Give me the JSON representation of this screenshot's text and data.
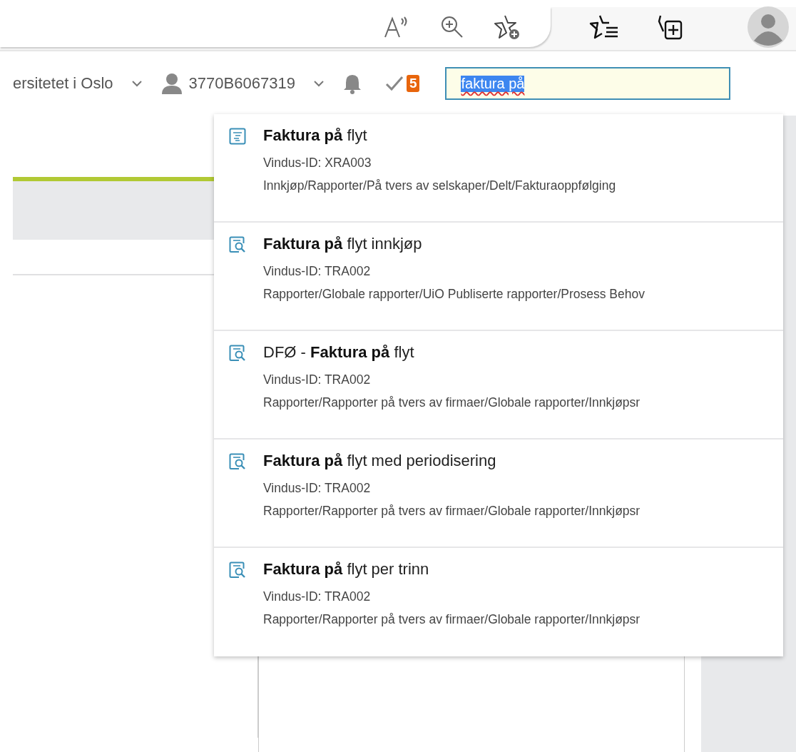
{
  "header": {
    "organization": "ersitetet i Oslo",
    "user": "3770B6067319",
    "task_count": "5"
  },
  "search": {
    "value": "faktura på",
    "text_selected": true
  },
  "results": [
    {
      "kind": "list",
      "title": "**Faktura på** flyt",
      "window_id": "Vindus-ID: XRA003",
      "path": "Innkjøp/Rapporter/På tvers av selskaper/Delt/Fakturaoppfølging"
    },
    {
      "kind": "report",
      "title": "**Faktura på** flyt innkjøp",
      "window_id": "Vindus-ID: TRA002",
      "path": "Rapporter/Globale rapporter/UiO Publiserte rapporter/Prosess Behov"
    },
    {
      "kind": "report",
      "title": "DFØ - **Faktura på** flyt",
      "window_id": "Vindus-ID: TRA002",
      "path": "Rapporter/Rapporter på tvers av firmaer/Globale rapporter/Innkjøpsr"
    },
    {
      "kind": "report",
      "title": "**Faktura på** flyt med periodisering",
      "window_id": "Vindus-ID: TRA002",
      "path": "Rapporter/Rapporter på tvers av firmaer/Globale rapporter/Innkjøpsr"
    },
    {
      "kind": "report",
      "title": "**Faktura på** flyt per trinn",
      "window_id": "Vindus-ID: TRA002",
      "path": "Rapporter/Rapporter på tvers av firmaer/Globale rapporter/Innkjøpsr"
    }
  ]
}
